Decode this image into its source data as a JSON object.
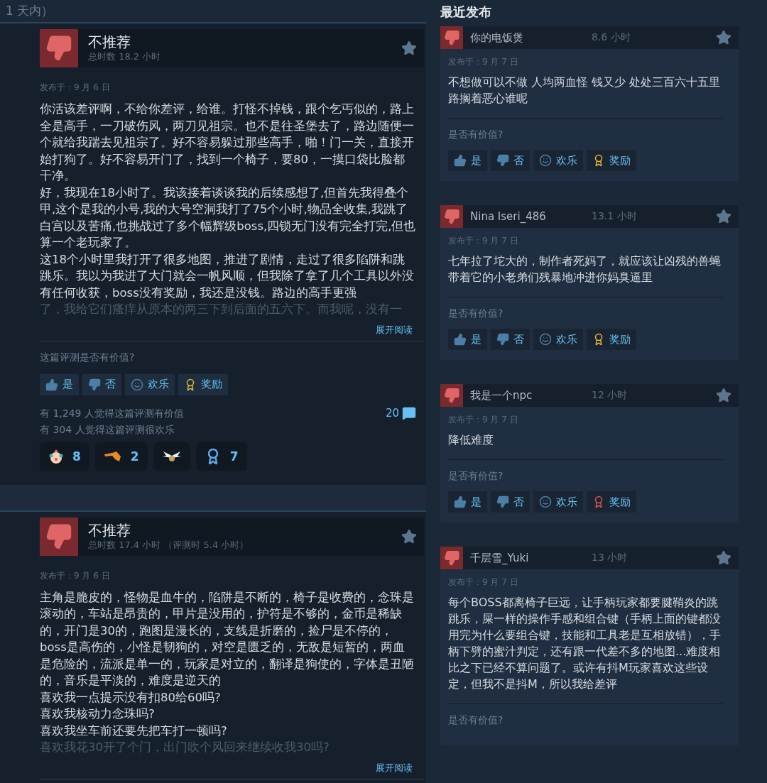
{
  "header_fragment": "1 天内）",
  "reviews": [
    {
      "verdict": "不推荐",
      "hours": "总时数 18.2 小时",
      "posted": "发布于：9 月 6 日",
      "paragraphs": [
        "你活该差评啊，不给你差评，给谁。打怪不掉钱，跟个乞丐似的，路上全是高手，一刀破伤风，两刀见祖宗。也不是往圣堡去了，路边随便一个就给我踹去见祖宗了。好不容易躲过那些高手，啪！门一关，直接开始打狗了。好不容易开门了，找到一个椅子，要80，一摸口袋比脸都干净。",
        "好，我现在18小时了。我该接着谈谈我的后续感想了,但首先我得叠个甲,这个是我的小号,我的大号空洞我打了75个小时,物品全收集,我跳了白宫以及苦痛,也挑战过了多个幅辉级boss,四锁无门没有完全打完,但也算一个老玩家了。",
        "这18个小时里我打开了很多地图，推进了剧情，走过了很多陷阱和跳跳乐。我以为我进了大门就会一帆风顺，但我除了拿了几个工具以外没有任何收获，boss没有奖励，我还是没钱。路边的高手更强"
      ],
      "faded": "了，我给它们瘙痒从原本的两三下到后面的五六下。而我呢，没有一",
      "expand": "展开阅读",
      "question": "这篇评测是否有价值?",
      "buttons": [
        {
          "kind": "yes",
          "label": "是"
        },
        {
          "kind": "no",
          "label": "否"
        },
        {
          "kind": "funny",
          "label": "欢乐"
        },
        {
          "kind": "award",
          "label": "奖励",
          "color": "#e8b53a"
        }
      ],
      "helpful": [
        "有 1,249 人觉得这篇评测有价值",
        "有 304 人觉得这篇评测很欢乐"
      ],
      "comment_count": "20",
      "awards": [
        {
          "kind": "clown",
          "count": "8"
        },
        {
          "kind": "horse",
          "count": "2"
        },
        {
          "kind": "wings"
        },
        {
          "kind": "ribbon",
          "count": "7"
        }
      ]
    },
    {
      "verdict": "不推荐",
      "hours": "总时数 17.4 小时 （评测时 5.4 小时）",
      "posted": "发布于：9 月 6 日",
      "paragraphs": [
        "主角是脆皮的，怪物是血牛的，陷阱是不断的，椅子是收费的，念珠是滚动的，车站是昂贵的，甲片是没用的，护符是不够的，金币是稀缺的，开门是30的，跑图是漫长的，支线是折磨的，捡尸是不停的，boss是高伤的，小怪是韧狗的，对空是匮乏的，无敌是短暂的，两血是危险的，流派是单一的，玩家是对立的，翻译是狗使的，字体是丑陋的，音乐是平淡的，难度是逆天的",
        "喜欢我一点提示没有扣80给60吗?",
        "喜欢我核动力念珠吗?",
        "喜欢我坐车前还要先把车打一顿吗?"
      ],
      "faded": "喜欢我花30开了个门，出门吹个风回来继续收我30吗?",
      "expand": "展开阅读"
    }
  ],
  "recent": {
    "title": "最近发布",
    "reviews": [
      {
        "name": "你的电饭煲",
        "hours": "8.6 小时",
        "posted": "发布于：9 月 7 日",
        "text": "不想做可以不做 人均两血怪 钱又少 处处三百六十五里路搁着恶心谁呢",
        "question": "是否有价值?",
        "buttons": [
          {
            "kind": "yes",
            "label": "是"
          },
          {
            "kind": "no",
            "label": "否"
          },
          {
            "kind": "funny",
            "label": "欢乐"
          },
          {
            "kind": "award",
            "label": "奖励",
            "color": "#e8b53a"
          }
        ]
      },
      {
        "name": "Nina Iseri_486",
        "hours": "13.1 小时",
        "posted": "发布于：9 月 7 日",
        "text": "七年拉了坨大的，制作者死妈了，就应该让凶残的兽蝇带着它的小老弟们残暴地冲进你妈臭逼里",
        "question": "是否有价值?",
        "buttons": [
          {
            "kind": "yes",
            "label": "是"
          },
          {
            "kind": "no",
            "label": "否"
          },
          {
            "kind": "funny",
            "label": "欢乐"
          },
          {
            "kind": "award",
            "label": "奖励",
            "color": "#e8b53a"
          }
        ]
      },
      {
        "name": "我是一个npc",
        "hours": "12 小时",
        "posted": "发布于：9 月 7 日",
        "text": "降低难度",
        "question": "是否有价值?",
        "buttons": [
          {
            "kind": "yes",
            "label": "是"
          },
          {
            "kind": "no",
            "label": "否"
          },
          {
            "kind": "funny",
            "label": "欢乐"
          },
          {
            "kind": "award",
            "label": "奖励",
            "color": "#d9534f"
          }
        ]
      },
      {
        "name": "千层雪_Yuki",
        "hours": "13 小时",
        "posted": "发布于：9 月 7 日",
        "text": "每个BOSS都离椅子巨远，让手柄玩家都要腱鞘炎的跳跳乐，屎一样的操作手感和组合键（手柄上面的键都没用完为什么要组合键，技能和工具老是互相放错），手柄下劈的蜜汁判定，还有跟一代差不多的地图...难度相比之下已经不算问题了。或许有抖M玩家喜欢这些设定，但我不是抖M，所以我给差评",
        "question": "是否有价值?"
      }
    ]
  }
}
